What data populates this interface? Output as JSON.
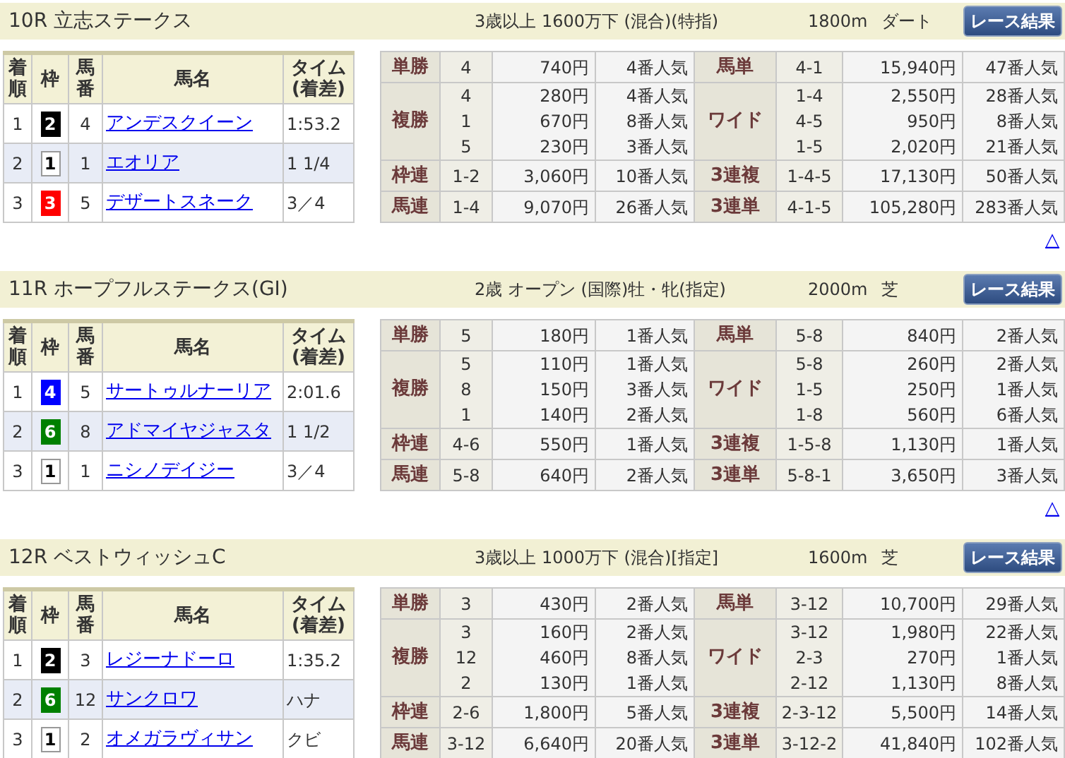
{
  "races": [
    {
      "title": "10R 立志ステークス",
      "conditions": "3歳以上 1600万下 (混合)(特指)",
      "distance": "1800m",
      "surface": "ダート",
      "button": "レース結果",
      "result_columns": [
        "着順",
        "枠",
        "馬番",
        "馬名",
        "タイム(着差)"
      ],
      "results": [
        {
          "finish": "1",
          "frame": "2",
          "color": "#000000",
          "number": "4",
          "name": "アンデスクイーン",
          "time": "1:53.2"
        },
        {
          "finish": "2",
          "frame": "1",
          "color": "#ffffff",
          "number": "1",
          "name": "エオリア",
          "time": "1 1/4"
        },
        {
          "finish": "3",
          "frame": "3",
          "color": "#ff0000",
          "number": "5",
          "name": "デザートスネーク",
          "time": "3／4"
        }
      ],
      "payout_groups": [
        {
          "left": {
            "label": "単勝",
            "entries": [
              {
                "combo": "4",
                "amount": "740円",
                "popularity": "4番人気"
              }
            ]
          },
          "right": {
            "label": "馬単",
            "entries": [
              {
                "combo": "4-1",
                "amount": "15,940円",
                "popularity": "47番人気"
              }
            ]
          }
        },
        {
          "left": {
            "label": "複勝",
            "entries": [
              {
                "combo": "4",
                "amount": "280円",
                "popularity": "4番人気"
              },
              {
                "combo": "1",
                "amount": "670円",
                "popularity": "8番人気"
              },
              {
                "combo": "5",
                "amount": "230円",
                "popularity": "3番人気"
              }
            ]
          },
          "right": {
            "label": "ワイド",
            "entries": [
              {
                "combo": "1-4",
                "amount": "2,550円",
                "popularity": "28番人気"
              },
              {
                "combo": "4-5",
                "amount": "950円",
                "popularity": "8番人気"
              },
              {
                "combo": "1-5",
                "amount": "2,020円",
                "popularity": "21番人気"
              }
            ]
          }
        },
        {
          "left": {
            "label": "枠連",
            "entries": [
              {
                "combo": "1-2",
                "amount": "3,060円",
                "popularity": "10番人気"
              }
            ]
          },
          "right": {
            "label": "3連複",
            "entries": [
              {
                "combo": "1-4-5",
                "amount": "17,130円",
                "popularity": "50番人気"
              }
            ]
          }
        },
        {
          "left": {
            "label": "馬連",
            "entries": [
              {
                "combo": "1-4",
                "amount": "9,070円",
                "popularity": "26番人気"
              }
            ]
          },
          "right": {
            "label": "3連単",
            "entries": [
              {
                "combo": "4-1-5",
                "amount": "105,280円",
                "popularity": "283番人気"
              }
            ]
          }
        }
      ],
      "top_link": "△"
    },
    {
      "title": "11R ホープフルステークス(GI)",
      "conditions": "2歳 オープン (国際)牡・牝(指定)",
      "distance": "2000m",
      "surface": "芝",
      "button": "レース結果",
      "result_columns": [
        "着順",
        "枠",
        "馬番",
        "馬名",
        "タイム(着差)"
      ],
      "results": [
        {
          "finish": "1",
          "frame": "4",
          "color": "#0000ff",
          "number": "5",
          "name": "サートゥルナーリア",
          "time": "2:01.6"
        },
        {
          "finish": "2",
          "frame": "6",
          "color": "#008000",
          "number": "8",
          "name": "アドマイヤジャスタ",
          "time": "1 1/2"
        },
        {
          "finish": "3",
          "frame": "1",
          "color": "#ffffff",
          "number": "1",
          "name": "ニシノデイジー",
          "time": "3／4"
        }
      ],
      "payout_groups": [
        {
          "left": {
            "label": "単勝",
            "entries": [
              {
                "combo": "5",
                "amount": "180円",
                "popularity": "1番人気"
              }
            ]
          },
          "right": {
            "label": "馬単",
            "entries": [
              {
                "combo": "5-8",
                "amount": "840円",
                "popularity": "2番人気"
              }
            ]
          }
        },
        {
          "left": {
            "label": "複勝",
            "entries": [
              {
                "combo": "5",
                "amount": "110円",
                "popularity": "1番人気"
              },
              {
                "combo": "8",
                "amount": "150円",
                "popularity": "3番人気"
              },
              {
                "combo": "1",
                "amount": "140円",
                "popularity": "2番人気"
              }
            ]
          },
          "right": {
            "label": "ワイド",
            "entries": [
              {
                "combo": "5-8",
                "amount": "260円",
                "popularity": "2番人気"
              },
              {
                "combo": "1-5",
                "amount": "250円",
                "popularity": "1番人気"
              },
              {
                "combo": "1-8",
                "amount": "560円",
                "popularity": "6番人気"
              }
            ]
          }
        },
        {
          "left": {
            "label": "枠連",
            "entries": [
              {
                "combo": "4-6",
                "amount": "550円",
                "popularity": "1番人気"
              }
            ]
          },
          "right": {
            "label": "3連複",
            "entries": [
              {
                "combo": "1-5-8",
                "amount": "1,130円",
                "popularity": "1番人気"
              }
            ]
          }
        },
        {
          "left": {
            "label": "馬連",
            "entries": [
              {
                "combo": "5-8",
                "amount": "640円",
                "popularity": "2番人気"
              }
            ]
          },
          "right": {
            "label": "3連単",
            "entries": [
              {
                "combo": "5-8-1",
                "amount": "3,650円",
                "popularity": "3番人気"
              }
            ]
          }
        }
      ],
      "top_link": "△"
    },
    {
      "title": "12R ベストウィッシュC",
      "conditions": "3歳以上 1000万下 (混合)[指定]",
      "distance": "1600m",
      "surface": "芝",
      "button": "レース結果",
      "result_columns": [
        "着順",
        "枠",
        "馬番",
        "馬名",
        "タイム(着差)"
      ],
      "results": [
        {
          "finish": "1",
          "frame": "2",
          "color": "#000000",
          "number": "3",
          "name": "レジーナドーロ",
          "time": "1:35.2"
        },
        {
          "finish": "2",
          "frame": "6",
          "color": "#008000",
          "number": "12",
          "name": "サンクロワ",
          "time": "ハナ"
        },
        {
          "finish": "3",
          "frame": "1",
          "color": "#ffffff",
          "number": "2",
          "name": "オメガラヴィサン",
          "time": "クビ"
        }
      ],
      "payout_groups": [
        {
          "left": {
            "label": "単勝",
            "entries": [
              {
                "combo": "3",
                "amount": "430円",
                "popularity": "2番人気"
              }
            ]
          },
          "right": {
            "label": "馬単",
            "entries": [
              {
                "combo": "3-12",
                "amount": "10,700円",
                "popularity": "29番人気"
              }
            ]
          }
        },
        {
          "left": {
            "label": "複勝",
            "entries": [
              {
                "combo": "3",
                "amount": "160円",
                "popularity": "2番人気"
              },
              {
                "combo": "12",
                "amount": "460円",
                "popularity": "8番人気"
              },
              {
                "combo": "2",
                "amount": "130円",
                "popularity": "1番人気"
              }
            ]
          },
          "right": {
            "label": "ワイド",
            "entries": [
              {
                "combo": "3-12",
                "amount": "1,980円",
                "popularity": "22番人気"
              },
              {
                "combo": "2-3",
                "amount": "270円",
                "popularity": "1番人気"
              },
              {
                "combo": "2-12",
                "amount": "1,130円",
                "popularity": "8番人気"
              }
            ]
          }
        },
        {
          "left": {
            "label": "枠連",
            "entries": [
              {
                "combo": "2-6",
                "amount": "1,800円",
                "popularity": "5番人気"
              }
            ]
          },
          "right": {
            "label": "3連複",
            "entries": [
              {
                "combo": "2-3-12",
                "amount": "5,500円",
                "popularity": "14番人気"
              }
            ]
          }
        },
        {
          "left": {
            "label": "馬連",
            "entries": [
              {
                "combo": "3-12",
                "amount": "6,640円",
                "popularity": "20番人気"
              }
            ]
          },
          "right": {
            "label": "3連単",
            "entries": [
              {
                "combo": "3-12-2",
                "amount": "41,840円",
                "popularity": "102番人気"
              }
            ]
          }
        }
      ]
    }
  ]
}
